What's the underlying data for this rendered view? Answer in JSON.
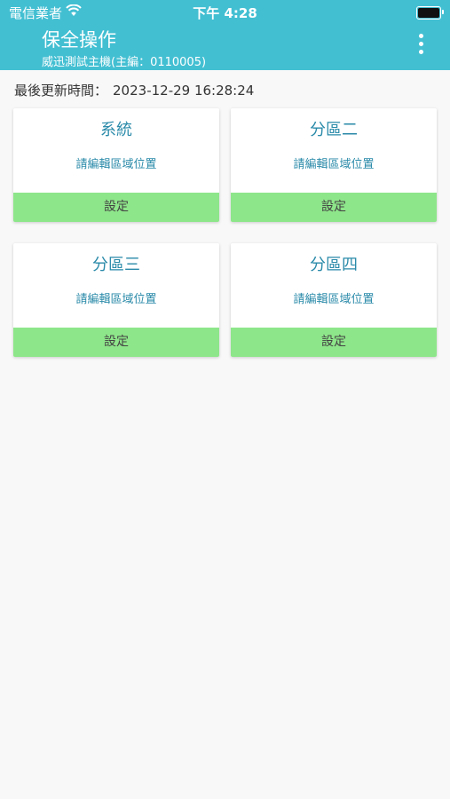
{
  "status": {
    "carrier": "電信業者",
    "time": "下午 4:28"
  },
  "header": {
    "title": "保全操作",
    "subtitle": "威迅測試主機(主編：0110005)"
  },
  "updated": {
    "label": "最後更新時間：",
    "timestamp": "2023-12-29 16:28:24"
  },
  "cards": [
    {
      "name": "系統",
      "location": "請編輯區域位置",
      "button": "設定"
    },
    {
      "name": "分區二",
      "location": "請編輯區域位置",
      "button": "設定"
    },
    {
      "name": "分區三",
      "location": "請編輯區域位置",
      "button": "設定"
    },
    {
      "name": "分區四",
      "location": "請編輯區域位置",
      "button": "設定"
    }
  ],
  "colors": {
    "header": "#43bfd2",
    "card_text": "#2a8aa9",
    "button": "#8ee68a"
  }
}
